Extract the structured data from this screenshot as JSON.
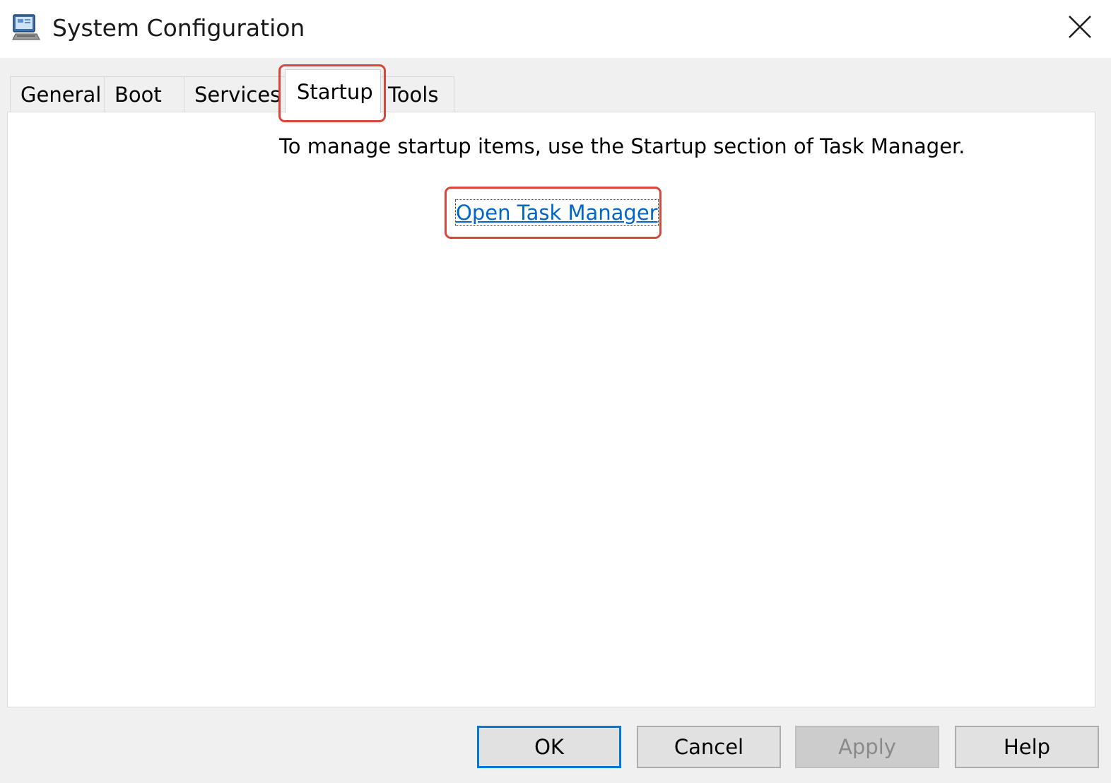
{
  "window": {
    "title": "System Configuration",
    "icon": "msconfig-computer-icon",
    "close_icon": "close-icon"
  },
  "tabs": [
    {
      "label": "General",
      "active": false
    },
    {
      "label": "Boot",
      "active": false
    },
    {
      "label": "Services",
      "active": false
    },
    {
      "label": "Startup",
      "active": true
    },
    {
      "label": "Tools",
      "active": false
    }
  ],
  "startup": {
    "message": "To manage startup items, use the Startup section of Task Manager.",
    "link_label": "Open Task Manager"
  },
  "buttons": {
    "ok": "OK",
    "cancel": "Cancel",
    "apply": "Apply",
    "help": "Help"
  },
  "colors": {
    "link": "#0066cc",
    "highlight": "#d9473b",
    "default_button_border": "#0078d7"
  }
}
